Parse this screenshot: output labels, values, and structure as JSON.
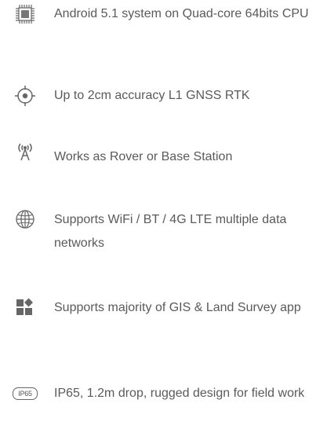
{
  "features": [
    {
      "icon": "cpu-chip-icon",
      "text": "Android 5.1 system on Quad-core 64bits CPU"
    },
    {
      "icon": "crosshair-target-icon",
      "text": "Up to 2cm accuracy L1 GNSS RTK"
    },
    {
      "icon": "radio-antenna-icon",
      "text": "Works as Rover or Base Station"
    },
    {
      "icon": "globe-icon",
      "text": "Supports WiFi / BT / 4G LTE multiple data networks"
    },
    {
      "icon": "apps-grid-icon",
      "text": "Supports majority of GIS & Land Survey app"
    },
    {
      "icon": "ip65-badge-icon",
      "badge": "IP65",
      "text": "IP65, 1.2m drop, rugged design for field work"
    }
  ]
}
